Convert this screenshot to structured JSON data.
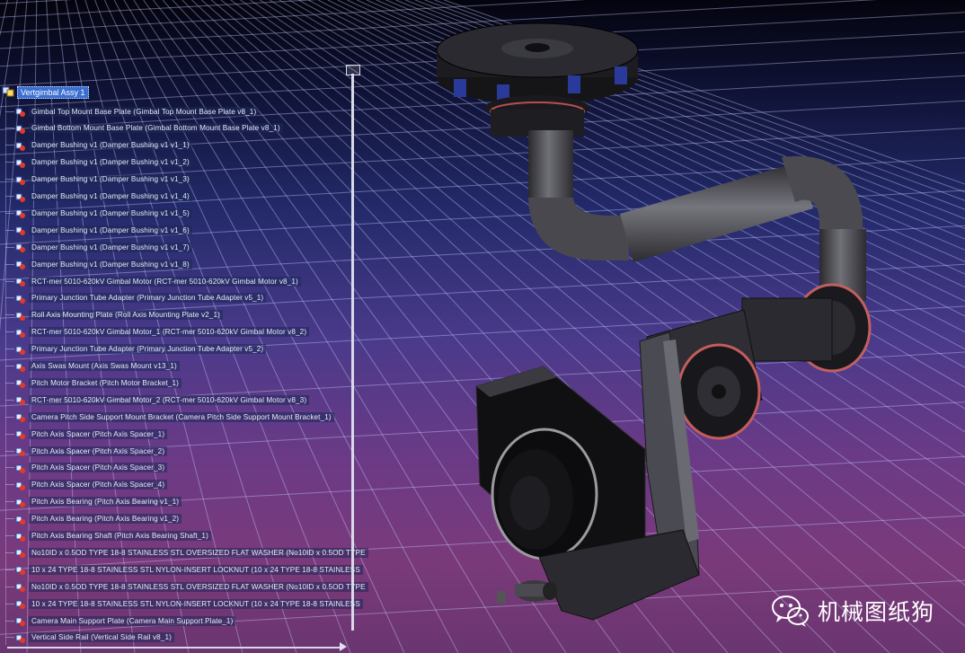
{
  "tree": {
    "root": "Vertgimbal Assy 1",
    "items": [
      "Gimbal Top Mount Base Plate (Gimbal Top Mount Base Plate v8_1)",
      "Gimbal Bottom Mount Base Plate (Gimbal Bottom Mount Base Plate v8_1)",
      "Damper Bushing v1 (Damper Bushing v1 v1_1)",
      "Damper Bushing v1 (Damper Bushing v1 v1_2)",
      "Damper Bushing v1 (Damper Bushing v1 v1_3)",
      "Damper Bushing v1 (Damper Bushing v1 v1_4)",
      "Damper Bushing v1 (Damper Bushing v1 v1_5)",
      "Damper Bushing v1 (Damper Bushing v1 v1_6)",
      "Damper Bushing v1 (Damper Bushing v1 v1_7)",
      "Damper Bushing v1 (Damper Bushing v1 v1_8)",
      "RCT-mer 5010-620kV Gimbal Motor (RCT-mer 5010-620kV Gimbal Motor v8_1)",
      "Primary Junction Tube Adapter (Primary Junction Tube Adapter v5_1)",
      "Roll Axis Mounting Plate (Roll Axis Mounting Plate v2_1)",
      "RCT-mer 5010-620kV Gimbal Motor_1 (RCT-mer 5010-620kV Gimbal Motor v8_2)",
      "Primary Junction Tube Adapter (Primary Junction Tube Adapter v5_2)",
      "Axis Swas Mount (Axis Swas Mount v13_1)",
      "Pitch Motor Bracket (Pitch Motor Bracket_1)",
      "RCT-mer 5010-620kV Gimbal Motor_2 (RCT-mer 5010-620kV Gimbal Motor v8_3)",
      "Camera Pitch Side Support Mount Bracket (Camera Pitch Side Support Mount Bracket_1)",
      "Pitch Axis Spacer (Pitch Axis Spacer_1)",
      "Pitch Axis Spacer (Pitch Axis Spacer_2)",
      "Pitch Axis Spacer (Pitch Axis Spacer_3)",
      "Pitch Axis Spacer (Pitch Axis Spacer_4)",
      "Pitch Axis Bearing (Pitch Axis Bearing v1_1)",
      "Pitch Axis Bearing (Pitch Axis Bearing v1_2)",
      "Pitch Axis Bearing Shaft (Pitch Axis Bearing Shaft_1)",
      "No10ID x 0.5OD TYPE 18-8 STAINLESS STL OVERSIZED FLAT WASHER (No10ID x 0.5OD TYPE",
      "10 x 24 TYPE 18-8 STAINLESS STL NYLON-INSERT LOCKNUT (10 x 24 TYPE 18-8 STAINLESS",
      "No10ID x 0.5OD TYPE 18-8 STAINLESS STL OVERSIZED FLAT WASHER (No10ID x 0.5OD TYPE",
      "10 x 24 TYPE 18-8 STAINLESS STL NYLON-INSERT LOCKNUT (10 x 24 TYPE 18-8 STAINLESS",
      "Camera Main Support Plate (Camera Main Support Plate_1)",
      "Vertical Side Rail (Vertical Side Rail v8_1)"
    ]
  },
  "watermark": {
    "icon": "wechat-icon",
    "text": "机械图纸狗"
  },
  "colors": {
    "background_top": "#0d1030",
    "background_bottom": "#7a3a7a",
    "grid": "#c8ccff",
    "selection": "#3b6fd0"
  }
}
